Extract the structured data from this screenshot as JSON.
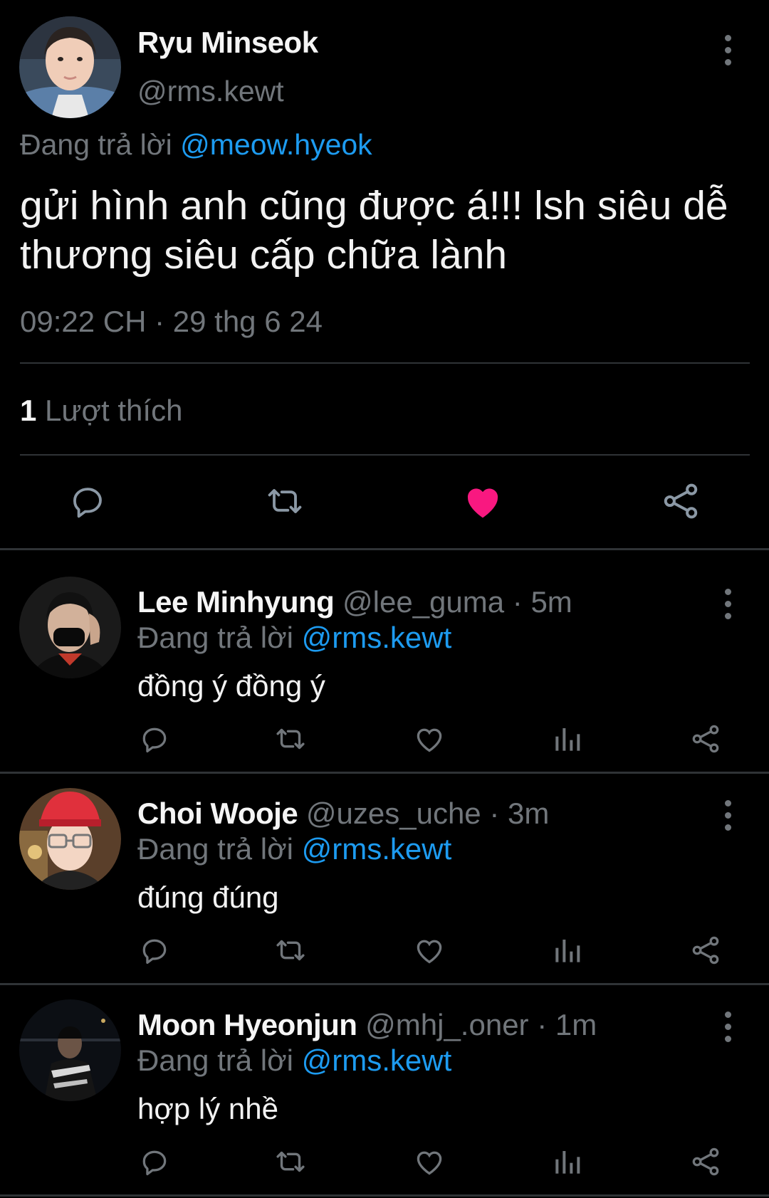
{
  "main_tweet": {
    "name": "Ryu Minseok",
    "handle": "@rms.kewt",
    "replying_prefix": "Đang trả lời",
    "replying_to": "@meow.hyeok",
    "text": "gửi hình anh cũng được á!!! lsh siêu dễ thương siêu cấp chữa lành",
    "timestamp": "09:22 CH · 29 thg 6 24",
    "like_count": "1",
    "like_label": "Lượt thích",
    "liked": true,
    "accent_like_color": "#f91880"
  },
  "replies": [
    {
      "name": "Lee Minhyung",
      "handle": "@lee_guma",
      "time": "· 5m",
      "replying_prefix": "Đang trả lời",
      "replying_to": "@rms.kewt",
      "text": "đồng ý đồng ý"
    },
    {
      "name": "Choi Wooje",
      "handle": "@uzes_uche",
      "time": "· 3m",
      "replying_prefix": "Đang trả lời",
      "replying_to": "@rms.kewt",
      "text": "đúng đúng"
    },
    {
      "name": "Moon Hyeonjun",
      "handle": "@mhj_.oner",
      "time": "· 1m",
      "replying_prefix": "Đang trả lời",
      "replying_to": "@rms.kewt",
      "text": "hợp lý nhề"
    }
  ],
  "colors": {
    "background": "#000000",
    "text": "#e7e9ea",
    "secondary": "#71767b",
    "link": "#1d9bf0",
    "divider": "#2f3336"
  }
}
